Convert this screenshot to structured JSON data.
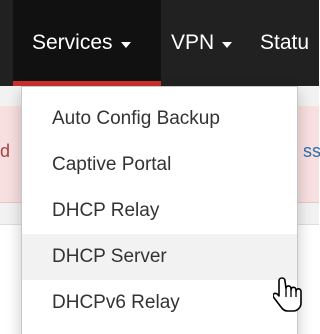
{
  "navbar": {
    "items": [
      {
        "label": "Services",
        "active": true,
        "has_caret": true
      },
      {
        "label": "VPN",
        "active": false,
        "has_caret": true
      },
      {
        "label": "Statu",
        "active": false,
        "has_caret": false
      }
    ],
    "background": "#212121",
    "active_background": "#111111",
    "active_underline_color": "#c9302c"
  },
  "background_page": {
    "alert_text_left": "d",
    "alert_link_right": "ss"
  },
  "dropdown": {
    "items": [
      {
        "label": "Auto Config Backup"
      },
      {
        "label": "Captive Portal"
      },
      {
        "label": "DHCP Relay"
      },
      {
        "label": "DHCP Server",
        "hovered": true
      },
      {
        "label": "DHCPv6 Relay"
      }
    ]
  },
  "cursor": {
    "icon": "hand-pointer-icon"
  }
}
